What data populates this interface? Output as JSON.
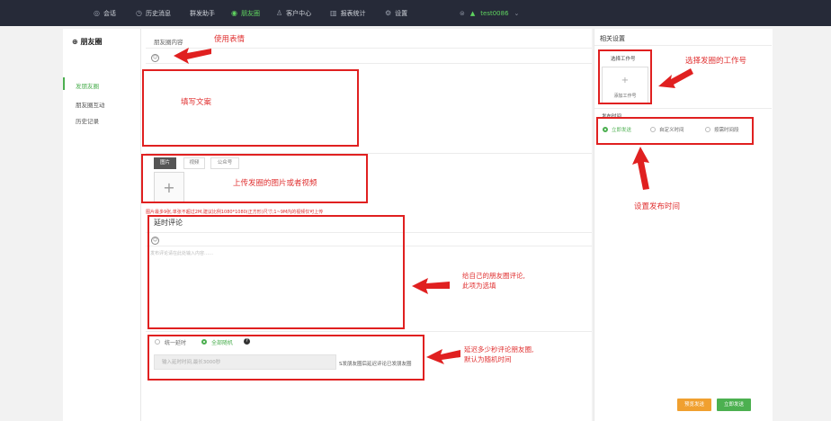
{
  "nav": {
    "items": [
      {
        "label": "会话",
        "icon": "chat-icon",
        "active": false
      },
      {
        "label": "历史消息",
        "icon": "clock-icon",
        "active": false
      },
      {
        "label": "群发助手",
        "icon": "",
        "active": false
      },
      {
        "label": "朋友圈",
        "icon": "moments-icon",
        "active": true
      },
      {
        "label": "客户中心",
        "icon": "person-icon",
        "active": false
      },
      {
        "label": "报表统计",
        "icon": "bar-chart-icon",
        "active": false
      },
      {
        "label": "设置",
        "icon": "gear-icon",
        "active": false
      }
    ],
    "user": "test0086"
  },
  "sidebar": {
    "title": "朋友圈",
    "items": [
      {
        "label": "发朋友圈",
        "active": true
      },
      {
        "label": "朋友圈互动",
        "active": false
      },
      {
        "label": "历史记录",
        "active": false
      }
    ]
  },
  "main": {
    "content_title": "朋友圈内容",
    "media_tabs": [
      "图片",
      "视频",
      "公众号"
    ],
    "upload_hint": "图片最多9张,单张不超过2M,建议比例1080*1080(正方形)尺寸;1~9M内的视频仅可上传",
    "comment_title": "延时评论",
    "comment_placeholder": "发布评论请在此处输入内容……",
    "delay_options": [
      "统一延时",
      "全部随机"
    ],
    "delay_placeholder": "输入延时时间,最长3000秒",
    "delay_hint": "S发朋友圈后延迟评论已发朋友圈"
  },
  "right": {
    "title": "相关设置",
    "account_label": "选择工作号",
    "add_account": "添加工作号",
    "time_label": "发布时间",
    "time_options": [
      "立即发送",
      "自定义时间",
      "按需时间段"
    ],
    "btn_schedule": "预览发送",
    "btn_send": "立即发送"
  },
  "annotations": {
    "emoji": "使用表情",
    "copy": "填写文案",
    "media": "上传发圈的图片或者视频",
    "comment_line1": "给自己的朋友圈评论,",
    "comment_line2": "此项为选填",
    "delay_line1": "延迟多少秒评论朋友圈,",
    "delay_line2": "默认为随机时间",
    "account": "选择发圈的工作号",
    "time": "设置发布时间"
  },
  "colors": {
    "accent": "#4caf50",
    "annotation": "#e02020",
    "topbar": "#262a38",
    "warn": "#f0a030"
  }
}
